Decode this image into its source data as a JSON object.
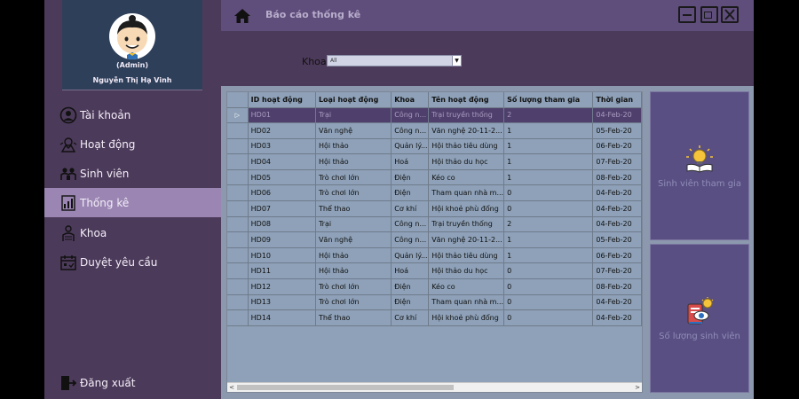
{
  "profile": {
    "role": "(Admin)",
    "name": "Nguyễn Thị Hạ Vinh"
  },
  "nav": [
    {
      "label": "Tài khoản",
      "icon": "user-circle-icon"
    },
    {
      "label": "Hoạt động",
      "icon": "activity-icon"
    },
    {
      "label": "Sinh viên",
      "icon": "students-icon"
    },
    {
      "label": "Thống kê",
      "icon": "statistics-icon",
      "active": true
    },
    {
      "label": "Khoa",
      "icon": "faculty-icon"
    },
    {
      "label": "Duyệt yêu cầu",
      "icon": "calendar-approve-icon"
    }
  ],
  "logout": {
    "label": "Đăng xuất"
  },
  "header": {
    "title": "Báo cáo thống kê"
  },
  "filter": {
    "label": "Khoa",
    "selected": "All"
  },
  "table": {
    "columns": [
      "ID hoạt động",
      "Loại hoạt động",
      "Khoa",
      "Tên hoạt động",
      "Số lượng tham gia",
      "Thời gian"
    ],
    "rows": [
      [
        "HD01",
        "Trại",
        "Công n...",
        "Trại truyền thống",
        "2",
        "04-Feb-20"
      ],
      [
        "HD02",
        "Văn nghệ",
        "Công n...",
        "Văn nghệ 20-11-2...",
        "1",
        "05-Feb-20"
      ],
      [
        "HD03",
        "Hội thảo",
        "Quản lý...",
        "Hội thảo tiêu dùng",
        "1",
        "06-Feb-20"
      ],
      [
        "HD04",
        "Hội thảo",
        "Hoá",
        "Hội thảo du học",
        "1",
        "07-Feb-20"
      ],
      [
        "HD05",
        "Trò chơi lớn",
        "Điện",
        "Kéo co",
        "1",
        "08-Feb-20"
      ],
      [
        "HD06",
        "Trò chơi lớn",
        "Điện",
        "Tham quan nhà m...",
        "0",
        "04-Feb-20"
      ],
      [
        "HD07",
        "Thể thao",
        "Cơ khí",
        "Hội khoẻ phù đổng",
        "0",
        "04-Feb-20"
      ],
      [
        "HD08",
        "Trại",
        "Công n...",
        "Trại truyền thống",
        "2",
        "04-Feb-20"
      ],
      [
        "HD09",
        "Văn nghệ",
        "Công n...",
        "Văn nghệ 20-11-2...",
        "1",
        "05-Feb-20"
      ],
      [
        "HD10",
        "Hội thảo",
        "Quản lý...",
        "Hội thảo tiêu dùng",
        "1",
        "06-Feb-20"
      ],
      [
        "HD11",
        "Hội thảo",
        "Hoá",
        "Hội thảo du học",
        "0",
        "07-Feb-20"
      ],
      [
        "HD12",
        "Trò chơi lớn",
        "Điện",
        "Kéo co",
        "0",
        "08-Feb-20"
      ],
      [
        "HD13",
        "Trò chơi lớn",
        "Điện",
        "Tham quan nhà m...",
        "0",
        "04-Feb-20"
      ],
      [
        "HD14",
        "Thể thao",
        "Cơ khí",
        "Hội khoẻ phù đổng",
        "0",
        "04-Feb-20"
      ]
    ],
    "selected_row": 0
  },
  "cards": [
    {
      "label": "Sinh viên tham gia",
      "icon": "lightbulb-book-icon"
    },
    {
      "label": "Số lượng sinh viên",
      "icon": "report-idea-icon"
    }
  ],
  "colors": {
    "sidebar": "#4c3a5a",
    "active_nav": "#9b86b3",
    "header": "#5f4d7c",
    "card": "#594f82"
  }
}
